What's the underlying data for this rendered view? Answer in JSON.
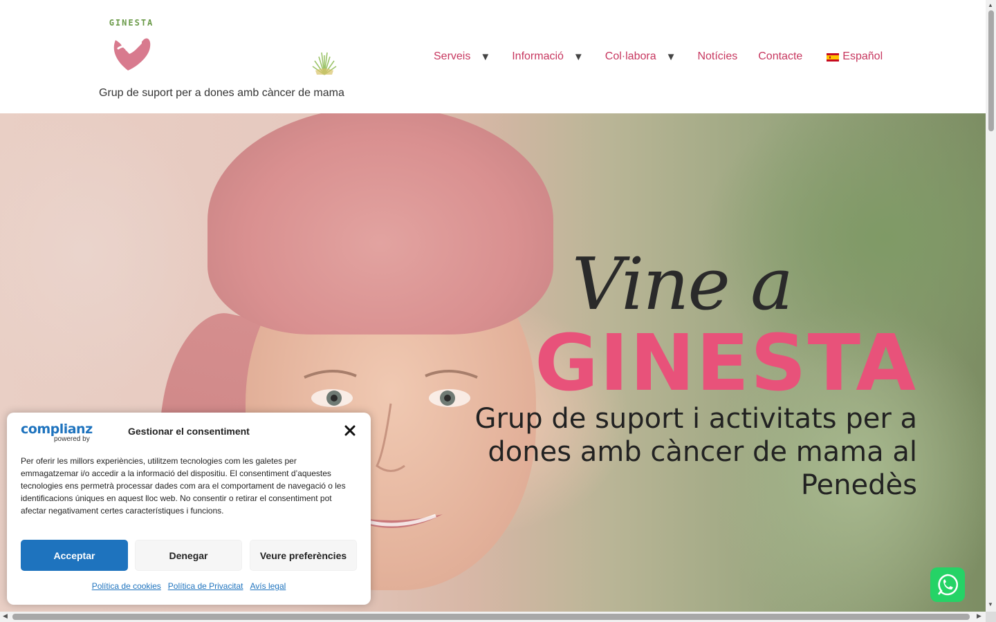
{
  "header": {
    "logo_text": "GINESTA",
    "tagline": "Grup de suport per a dones amb càncer de mama"
  },
  "nav": {
    "items": [
      {
        "label": "Serveis",
        "has_dropdown": true
      },
      {
        "label": "Informació",
        "has_dropdown": true
      },
      {
        "label": "Col·labora",
        "has_dropdown": true
      },
      {
        "label": "Notícies",
        "has_dropdown": false
      },
      {
        "label": "Contacte",
        "has_dropdown": false
      }
    ],
    "language": "Español",
    "dropdown_arrow": "▼"
  },
  "hero": {
    "script_line": "Vine a",
    "title": "GINESTA",
    "subtitle": "Grup de suport i activitats per a dones amb càncer de mama al Penedès"
  },
  "consent": {
    "brand": "complianz",
    "powered_by": "powered by",
    "title": "Gestionar el consentiment",
    "body": "Per oferir les millors experiències, utilitzem tecnologies com les galetes per emmagatzemar i/o accedir a la informació del dispositiu. El consentiment d’aquestes tecnologies ens permetrà processar dades com ara el comportament de navegació o les identificacions úniques en aquest lloc web. No consentir o retirar el consentiment pot afectar negativament certes característiques i funcions.",
    "accept": "Acceptar",
    "deny": "Denegar",
    "preferences": "Veure preferències",
    "links": [
      "Política de cookies",
      "Política de Privacitat",
      "Avís legal"
    ]
  },
  "colors": {
    "brand_pink": "#e8527a",
    "nav_pink": "#c7375f",
    "consent_blue": "#1e73be",
    "whatsapp_green": "#25d366"
  },
  "icons": {
    "close": "close-icon",
    "whatsapp": "whatsapp-icon",
    "flag": "spain-flag-icon"
  }
}
